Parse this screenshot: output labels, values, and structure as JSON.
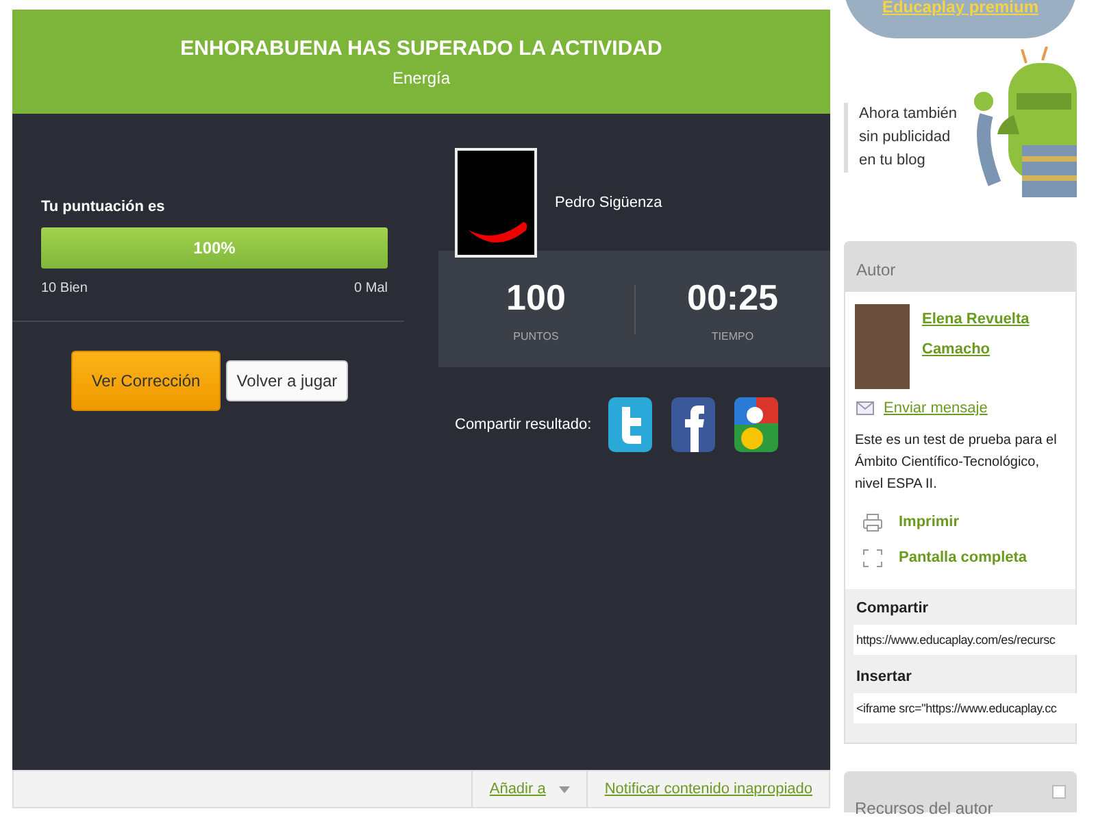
{
  "header": {
    "title": "ENHORABUENA HAS SUPERADO LA ACTIVIDAD",
    "subtitle": "Energía"
  },
  "score": {
    "label": "Tu puntuación es",
    "level": 1,
    "percent": "100%",
    "correct": "10 Bien",
    "wrong": "0 Mal"
  },
  "buttons": [
    {
      "label": "Ver Corrección",
      "kind": "primary"
    },
    {
      "label": "Volver a jugar",
      "kind": "secondary"
    }
  ],
  "player": {
    "name": "Pedro Sigüenza"
  },
  "stats": [
    {
      "value": "100",
      "label": "PUNTOS"
    },
    {
      "value": "00:25",
      "label": "TIEMPO"
    }
  ],
  "share": {
    "label": "Compartir resultado:",
    "networks": [
      {
        "kind": "twitter"
      },
      {
        "kind": "facebook"
      },
      {
        "kind": "google"
      }
    ]
  },
  "footer_links": [
    {
      "label": "Añadir a",
      "dropdown": true
    },
    {
      "label": "Notificar contenido inapropiado",
      "dropdown": false
    }
  ],
  "promo": {
    "link": "Educaplay premium",
    "text": "Ahora también sin publicidad en tu blog"
  },
  "author_panel": {
    "title": "Autor",
    "name": "Elena Revuelta Camacho",
    "message_link": "Enviar mensaje",
    "description": "Este es un test de prueba para el Ámbito Científico-Tecnológico, nivel ESPA II.",
    "actions": [
      {
        "label": "Imprimir",
        "kind": "print"
      },
      {
        "label": "Pantalla completa",
        "kind": "fullscreen"
      }
    ],
    "share_label": "Compartir",
    "share_value": "https://www.educaplay.com/es/recursc",
    "embed_label": "Insertar",
    "embed_value": "<iframe src=\"https://www.educaplay.cc"
  },
  "next_panel": {
    "title": "Recursos del autor"
  }
}
